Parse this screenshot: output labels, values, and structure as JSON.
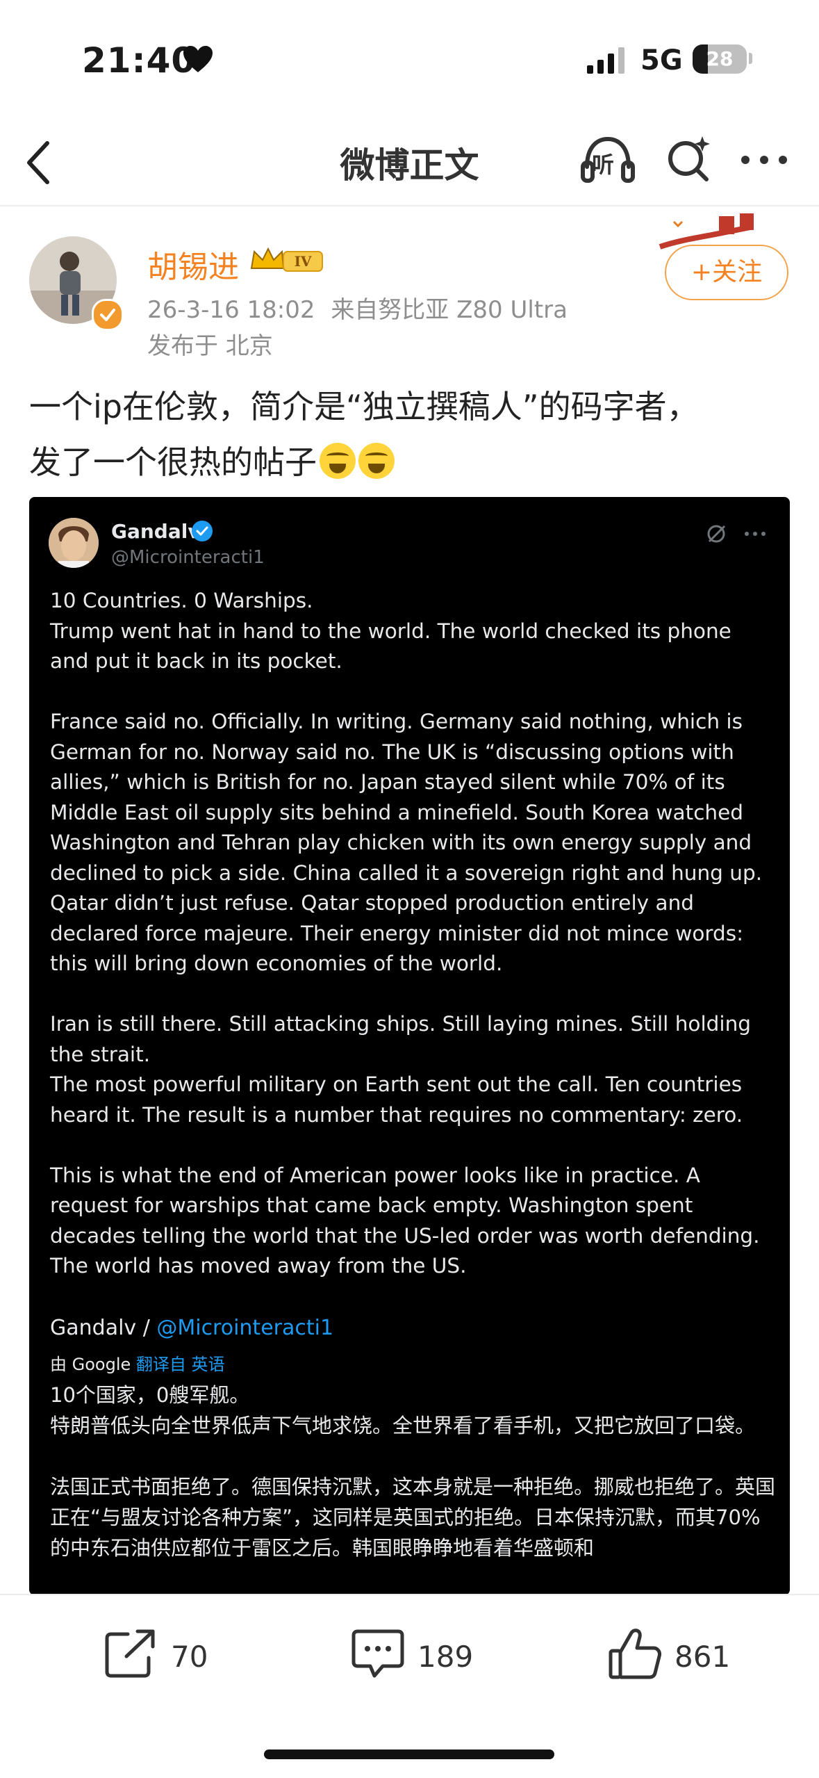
{
  "status_bar": {
    "time": "21:40",
    "network": "5G",
    "battery": "28",
    "battery_level": 0.28
  },
  "nav": {
    "title": "微博正文",
    "listen_label": "听"
  },
  "post": {
    "author": "胡锡进",
    "level_badge": "IV",
    "timestamp": "26-3-16 18:02",
    "source": "来自努比亚 Z80 Ultra",
    "location": "发布于 北京",
    "follow_label": "+关注",
    "text_line1": "一个ip在伦敦，简介是“独立撰稿人”的码字者，",
    "text_line2": "发了一个很热的帖子"
  },
  "tweet": {
    "name": "Gandalv",
    "handle": "@Microinteracti1",
    "paragraphs": [
      "10 Countries. 0 Warships.\nTrump went hat in hand to the world. The world checked its phone and put it back in its pocket.",
      "France said no. Officially. In writing. Germany said nothing, which is German for no. Norway said no. The UK is “discussing options with allies,” which is British for no. Japan stayed silent while 70% of its Middle East oil supply sits behind a minefield. South Korea watched Washington and Tehran play chicken with its own energy supply and declined to pick a side. China called it a sovereign right and hung up. Qatar didn’t just refuse. Qatar stopped production entirely and declared force majeure. Their energy minister did not mince words: this will bring down economies of the world.",
      "Iran is still there. Still attacking ships. Still laying mines. Still holding the strait.\nThe most powerful military on Earth sent out the call. Ten countries heard it. The result is a number that requires no commentary: zero.",
      "This is what the end of American power looks like in practice. A request for warships that came back empty. Washington spent decades telling the world that the US-led order was worth defending. The world has moved away from the US."
    ],
    "signature_name": "Gandalv / ",
    "signature_handle": "@Microinteracti1",
    "google_prefix": "由 Google ",
    "google_link": "翻译自 英语",
    "translated": [
      "10个国家，0艘军舰。\n特朗普低头向全世界低声下气地求饶。全世界看了看手机，又把它放回了口袋。",
      "法国正式书面拒绝了。德国保持沉默，这本身就是一种拒绝。挪威也拒绝了。英国正在“与盟友讨论各种方案”，这同样是英国式的拒绝。日本保持沉默，而其70%的中东石油供应都位于雷区之后。韩国眼睁睁地看着华盛顿和"
    ]
  },
  "actions": {
    "reposts": "70",
    "comments": "189",
    "likes": "861"
  },
  "colors": {
    "accent": "#f58220",
    "twitter_blue": "#1d9bf0",
    "tweet_bg": "#000000"
  },
  "icons": [
    "heart-icon",
    "signal-icon",
    "back-icon",
    "listen-icon",
    "search-icon",
    "more-icon",
    "verified-icon",
    "crown-icon",
    "share-icon",
    "comment-icon",
    "like-icon"
  ]
}
